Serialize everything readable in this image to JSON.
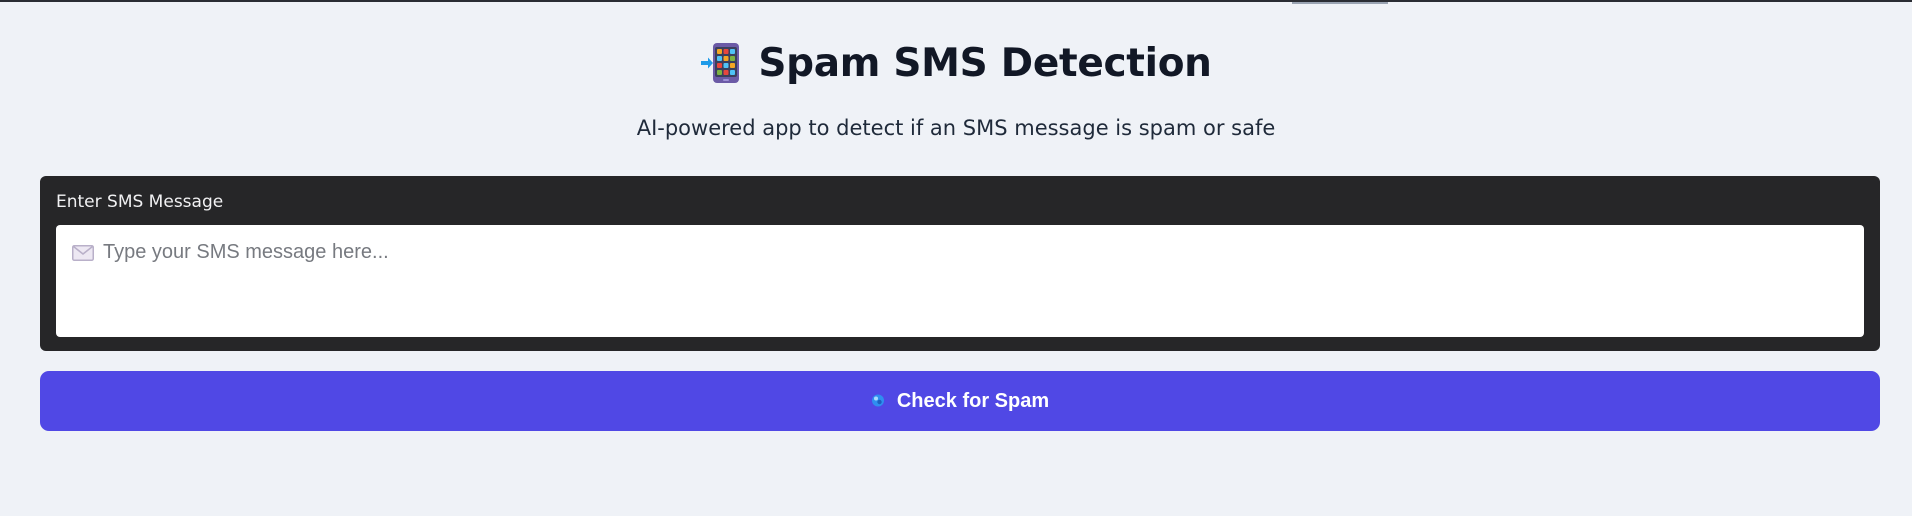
{
  "header": {
    "icon": "mobile-phone-arrow-icon",
    "title": "Spam SMS Detection",
    "subtitle": "AI-powered app to detect if an SMS message is spam or safe"
  },
  "form": {
    "label": "Enter SMS Message",
    "input_icon": "envelope-icon",
    "placeholder": "Type your SMS message here...",
    "value": ""
  },
  "action": {
    "icon": "crystal-ball-icon",
    "label": "Check for Spam"
  },
  "colors": {
    "page_background": "#eff2f7",
    "card_background": "#262628",
    "button_background": "#5048e5",
    "title_text": "#121826"
  }
}
